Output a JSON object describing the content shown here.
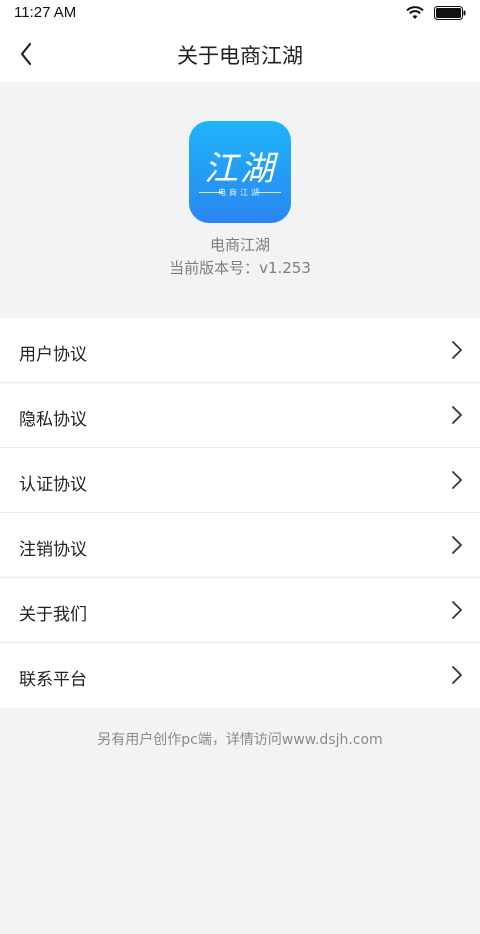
{
  "status_bar": {
    "time": "11:27 AM"
  },
  "nav": {
    "title": "关于电商江湖"
  },
  "app": {
    "logo_text": "江湖",
    "logo_subtext": "电商江湖",
    "name": "电商江湖",
    "version": "当前版本号：v1.253"
  },
  "menu": {
    "items": [
      {
        "label": "用户协议"
      },
      {
        "label": "隐私协议"
      },
      {
        "label": "认证协议"
      },
      {
        "label": "注销协议"
      },
      {
        "label": "关于我们"
      },
      {
        "label": "联系平台"
      }
    ]
  },
  "footer": {
    "note": "另有用户创作pc端，详情访问www.dsjh.com"
  },
  "colors": {
    "logo_top": "#1fb4fb",
    "logo_bottom": "#2a86f0",
    "background": "#f2f3f5"
  }
}
